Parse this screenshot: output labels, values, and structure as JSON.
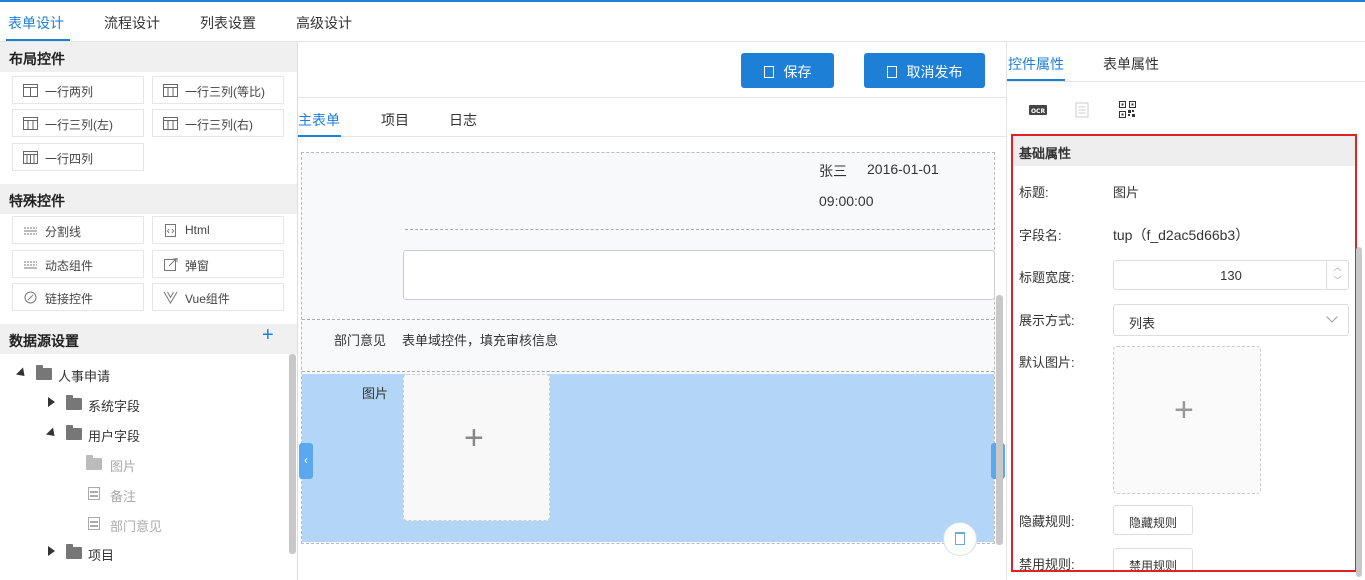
{
  "topnav": {
    "tabs": [
      {
        "label": "表单设计"
      },
      {
        "label": "流程设计"
      },
      {
        "label": "列表设置"
      },
      {
        "label": "高级设计"
      }
    ]
  },
  "left": {
    "layout_header": "布局控件",
    "layout_controls": [
      "一行两列",
      "一行三列(等比)",
      "一行三列(左)",
      "一行三列(右)",
      "一行四列"
    ],
    "special_header": "特殊控件",
    "special_controls": [
      "分割线",
      "Html",
      "动态组件",
      "弹窗",
      "链接控件",
      "Vue组件"
    ],
    "datasource_header": "数据源设置",
    "datasource_add": "+",
    "tree": [
      {
        "label": "人事申请"
      },
      {
        "label": "系统字段"
      },
      {
        "label": "用户字段"
      },
      {
        "label": "图片"
      },
      {
        "label": "备注"
      },
      {
        "label": "部门意见"
      },
      {
        "label": "项目"
      }
    ]
  },
  "center": {
    "save_label": "保存",
    "unpublish_label": "取消发布",
    "subtabs": [
      "主表单",
      "项目",
      "日志"
    ],
    "form": {
      "name": "张三",
      "date": "2016-01-01",
      "time": "09:00:00",
      "dept_label": "部门意见",
      "dept_value": "表单域控件，填充审核信息",
      "image_label": "图片",
      "image_plus": "+"
    }
  },
  "right": {
    "tabs": [
      "控件属性",
      "表单属性"
    ],
    "icons": [
      "ocr-icon",
      "document-icon",
      "qrcode-icon"
    ],
    "section_title": "基础属性",
    "props": {
      "title_label": "标题:",
      "title_value": "图片",
      "field_label": "字段名:",
      "field_value": "tup（f_d2ac5d66b3）",
      "width_label": "标题宽度:",
      "width_value": "130",
      "display_label": "展示方式:",
      "display_value": "列表",
      "default_img_label": "默认图片:",
      "hide_label": "隐藏规则:",
      "hide_button": "隐藏规则",
      "disable_label": "禁用规则:",
      "disable_button": "禁用规则"
    }
  },
  "colors": {
    "accent": "#1e7fd6",
    "selected_block": "#b3d6f7",
    "highlight_border": "#e02222"
  }
}
